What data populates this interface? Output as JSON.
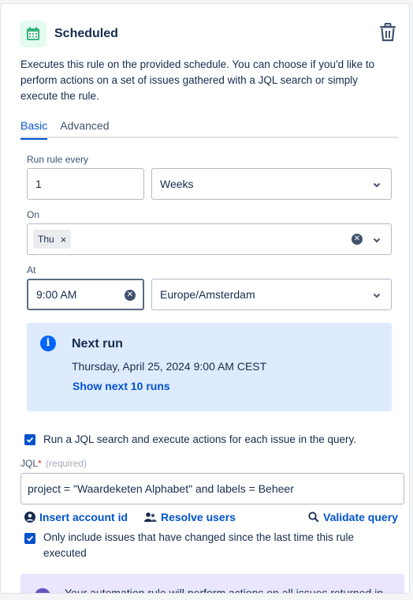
{
  "header": {
    "title": "Scheduled",
    "icon": "calendar-icon",
    "delete_icon": "trash-icon",
    "accent": "#36b37e"
  },
  "description": "Executes this rule on the provided schedule. You can choose if you'd like to perform actions on a set of issues gathered with a JQL search or simply execute the rule.",
  "tabs": [
    {
      "label": "Basic",
      "active": true
    },
    {
      "label": "Advanced",
      "active": false
    }
  ],
  "run_rule": {
    "label": "Run rule every",
    "interval_value": "1",
    "interval_unit": "Weeks"
  },
  "on": {
    "label": "On",
    "selected_days": [
      "Thu"
    ]
  },
  "at": {
    "label": "At",
    "time": "9:00 AM",
    "timezone": "Europe/Amsterdam"
  },
  "next_run": {
    "title": "Next run",
    "date": "Thursday, April 25, 2024 9:00 AM CEST",
    "link": "Show next 10 runs"
  },
  "jql_option": {
    "checked": true,
    "label": "Run a JQL search and execute actions for each issue in the query."
  },
  "jql": {
    "label": "JQL",
    "required_marker": "*",
    "required_hint": "(required)",
    "value": "project = \"Waardeketen Alphabet\" and labels = Beheer"
  },
  "jql_actions": {
    "insert_account": "Insert account id",
    "resolve_users": "Resolve users",
    "validate_query": "Validate query"
  },
  "changed_option": {
    "checked": true,
    "label": "Only include issues that have changed since the last time this rule executed"
  },
  "notice": {
    "text": "Your automation rule will perform actions on all issues returned in"
  },
  "colors": {
    "link": "#0052cc",
    "info_bg": "#deebff",
    "notice_bg": "#eae6ff"
  }
}
